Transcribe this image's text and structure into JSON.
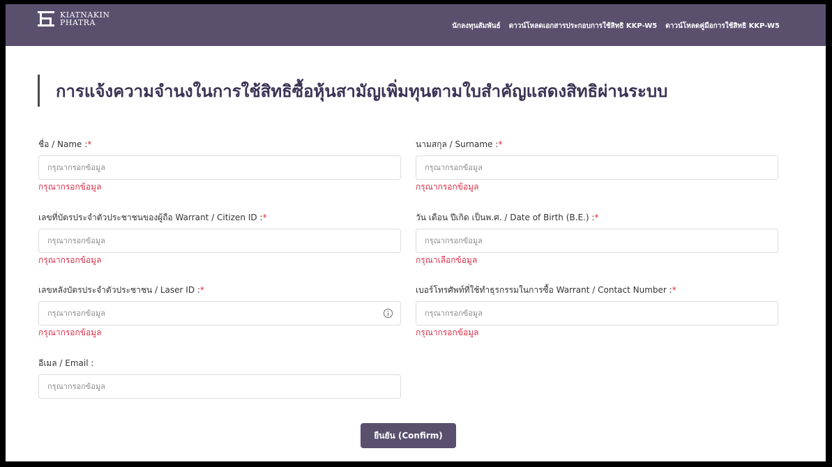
{
  "header": {
    "brand_line1": "KIATNAKIN",
    "brand_line2": "PHATRA",
    "nav": [
      "นักลงทุนสัมพันธ์",
      "ดาวน์โหลดเอกสารประกอบการใช้สิทธิ KKP-W5",
      "ดาวน์โหลดคู่มือการใช้สิทธิ KKP-W5"
    ]
  },
  "page_title": "การแจ้งความจำนงในการใช้สิทธิซื้อหุ้นสามัญเพิ่มทุนตามใบสำคัญแสดงสิทธิผ่านระบบ",
  "form": {
    "placeholder": "กรุณากรอกข้อมูล",
    "required_mark": "*",
    "fields": {
      "name": {
        "label": "ชื่อ / Name :",
        "error": "กรุณากรอกข้อมูล"
      },
      "surname": {
        "label": "นามสกุล / Surname :",
        "error": "กรุณากรอกข้อมูล"
      },
      "citizen_id": {
        "label": "เลขที่บัตรประจำตัวประชาชนของผู้ถือ Warrant / Citizen ID :",
        "error": "กรุณากรอกข้อมูล"
      },
      "dob": {
        "label": "วัน เดือน ปีเกิด เป็นพ.ศ. / Date of Birth (B.E.) :",
        "error": "กรุณาเลือกข้อมูล"
      },
      "laser_id": {
        "label": "เลขหลังบัตรประจำตัวประชาชน / Laser ID :",
        "error": "กรุณากรอกข้อมูล"
      },
      "contact": {
        "label": "เบอร์โทรศัพท์ที่ใช้ทำธุรกรรมในการซื้อ Warrant / Contact Number :",
        "error": "กรุณากรอกข้อมูล"
      },
      "email": {
        "label": "อีเมล / Email :"
      }
    },
    "confirm_label": "ยืนยัน (Confirm)"
  },
  "colors": {
    "brand": "#5b4f6e",
    "title": "#3c3355",
    "error": "#d9314a",
    "required": "#e0232e"
  },
  "icons": {
    "logo": "kiatnakin-logo-icon",
    "laser_info": "info-icon"
  }
}
